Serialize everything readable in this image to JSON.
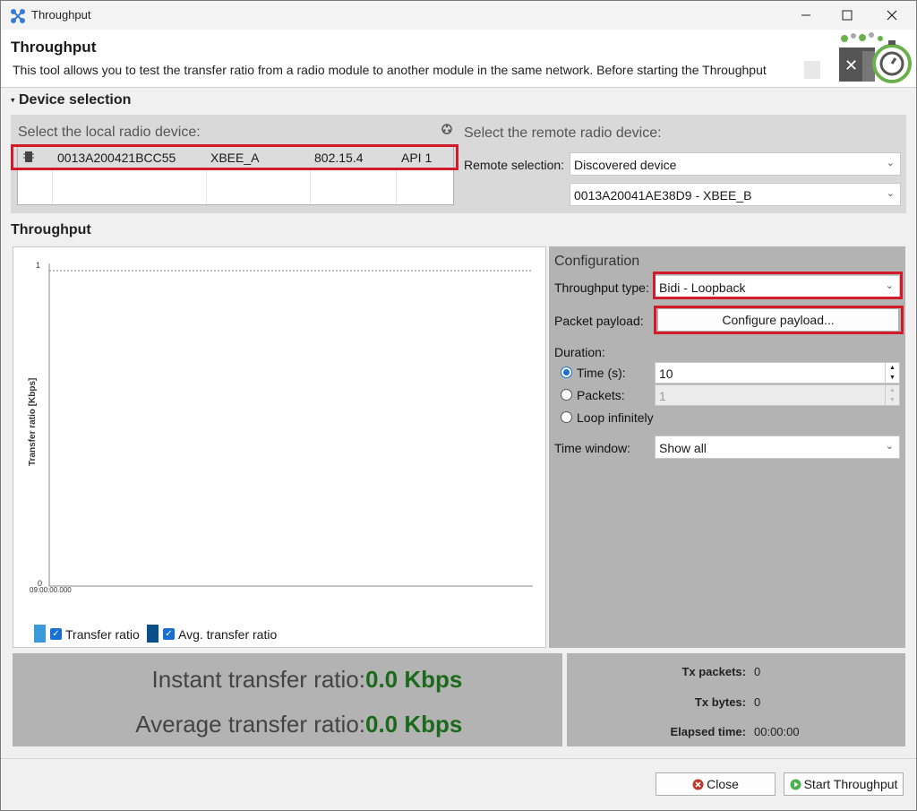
{
  "window": {
    "title": "Throughput"
  },
  "header": {
    "title": "Throughput",
    "description": "This tool allows you to test the transfer ratio from a radio module to another module in the same network. Before starting the Throughput"
  },
  "device_selection": {
    "section_label": "Device selection",
    "local_label": "Select the local radio device:",
    "local_device": {
      "address": "0013A200421BCC55",
      "name": "XBEE_A",
      "protocol": "802.15.4",
      "mode": "API 1"
    },
    "remote_label": "Select the remote radio device:",
    "remote_selection_label": "Remote selection:",
    "remote_selection_value": "Discovered device",
    "remote_device_value": "0013A20041AE38D9 - XBEE_B"
  },
  "throughput": {
    "section_label": "Throughput",
    "chart": {
      "ylabel": "Transfer ratio [Kbps]",
      "y_tick_top": "1",
      "y_tick_bottom": "0",
      "x_tick": "09:00:00.000"
    },
    "legend": [
      {
        "label": "Transfer ratio",
        "color": "#3a9ad9"
      },
      {
        "label": "Avg. transfer ratio",
        "color": "#0b4f8a"
      }
    ],
    "config": {
      "title": "Configuration",
      "type_label": "Throughput type:",
      "type_value": "Bidi - Loopback",
      "payload_label": "Packet payload:",
      "payload_button": "Configure payload...",
      "duration_label": "Duration:",
      "time_label": "Time (s):",
      "time_value": "10",
      "packets_label": "Packets:",
      "packets_value": "1",
      "loop_label": "Loop infinitely",
      "window_label": "Time window:",
      "window_value": "Show all"
    }
  },
  "stats": {
    "instant_label": "Instant transfer ratio:",
    "instant_value": "0.0 Kbps",
    "average_label": "Average transfer ratio:",
    "average_value": "0.0 Kbps",
    "tx_packets_label": "Tx packets:",
    "tx_packets_value": "0",
    "tx_bytes_label": "Tx bytes:",
    "tx_bytes_value": "0",
    "elapsed_label": "Elapsed time:",
    "elapsed_value": "00:00:00"
  },
  "footer": {
    "close_label": "Close",
    "start_label": "Start Throughput"
  },
  "colors": {
    "highlight": "#d11a2a",
    "value_green": "#1b6a1b",
    "panel_gray": "#b3b3b3"
  }
}
